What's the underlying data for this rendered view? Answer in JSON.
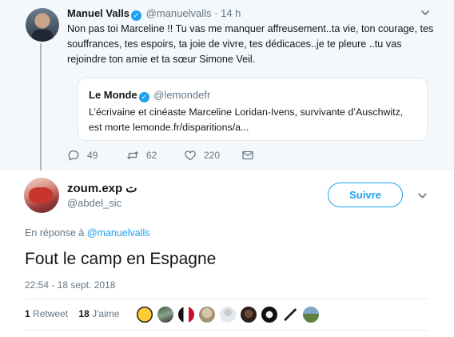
{
  "parent_tweet": {
    "name": "Manuel Valls",
    "handle": "@manuelvalls",
    "separator": "·",
    "time": "14 h",
    "text": "Non pas toi Marceline !! Tu vas me manquer affreusement..ta vie, ton courage, tes souffrances, tes espoirs, ta joie de vivre, tes dédicaces..je te pleure ..tu vas rejoindre ton amie et ta sœur Simone Veil.",
    "quote": {
      "name": "Le Monde",
      "handle": "@lemondefr",
      "text": "L’écrivaine et cinéaste Marceline Loridan-Ivens, survivante d’Auschwitz, est morte lemonde.fr/disparitions/a..."
    },
    "actions": {
      "replies": "49",
      "retweets": "62",
      "likes": "220"
    }
  },
  "reply_tweet": {
    "name": "zoum.exp ت",
    "handle": "@abdel_sic",
    "follow_label": "Suivre",
    "in_reply_prefix": "En réponse à",
    "in_reply_handle": "@manuelvalls",
    "text": "Fout le camp en Espagne",
    "timestamp": "22:54 - 18 sept. 2018",
    "stats": {
      "retweet_count": "1",
      "retweet_label": "Retweet",
      "like_count": "18",
      "like_label": "J'aime"
    }
  },
  "colors": {
    "accent": "#1da1f2",
    "muted": "#657786",
    "parent_bg": "#f5f8fa"
  }
}
